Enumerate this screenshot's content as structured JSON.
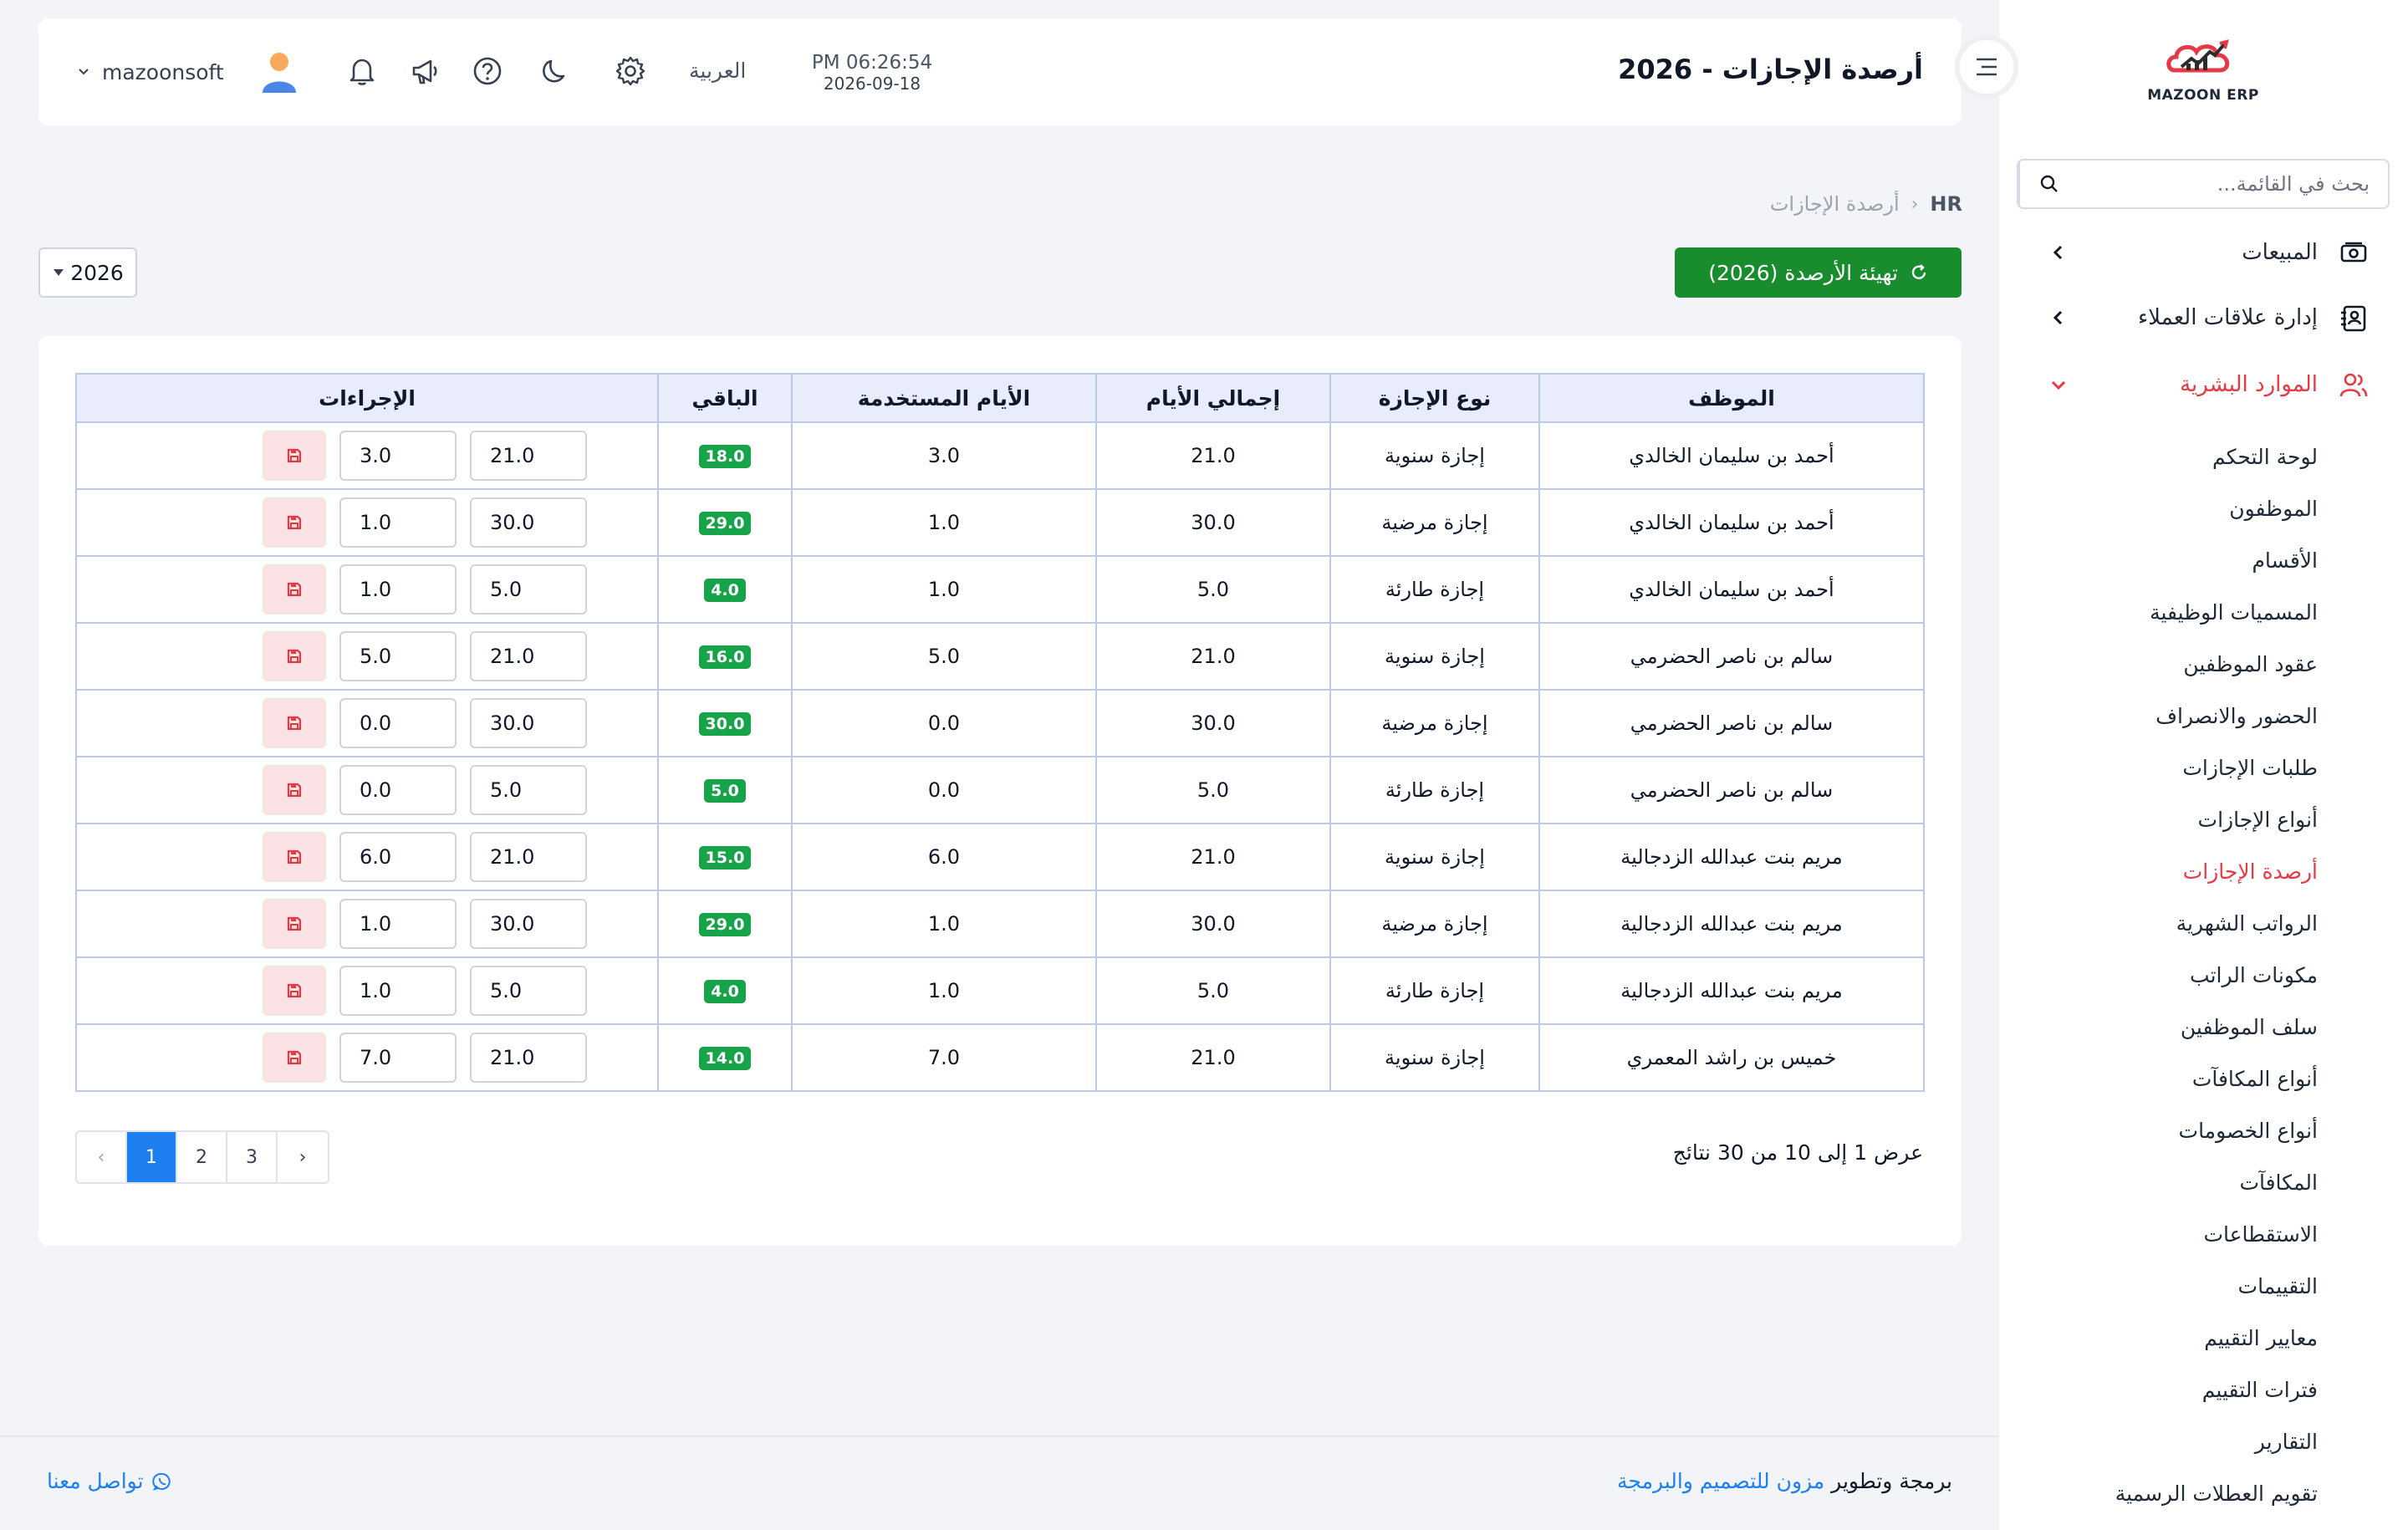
{
  "brand": {
    "logo_text": "MAZOON ERP"
  },
  "sidebar": {
    "search_placeholder": "بحث في القائمة...",
    "groups": [
      {
        "label": "المبيعات",
        "icon": "cash-icon"
      },
      {
        "label": "إدارة علاقات العملاء",
        "icon": "contacts-icon"
      },
      {
        "label": "الموارد البشرية",
        "icon": "users-icon"
      }
    ],
    "hr_items": [
      "لوحة التحكم",
      "الموظفون",
      "الأقسام",
      "المسميات الوظيفية",
      "عقود الموظفين",
      "الحضور والانصراف",
      "طلبات الإجازات",
      "أنواع الإجازات",
      "أرصدة الإجازات",
      "الرواتب الشهرية",
      "مكونات الراتب",
      "سلف الموظفين",
      "أنواع المكافآت",
      "أنواع الخصومات",
      "المكافآت",
      "الاستقطاعات",
      "التقييمات",
      "معايير التقييم",
      "فترات التقييم",
      "التقارير",
      "تقويم العطلات الرسمية"
    ],
    "active_item": "أرصدة الإجازات"
  },
  "header": {
    "title": "أرصدة الإجازات - 2026",
    "time": "PM 06:26:54",
    "date": "2026-09-18",
    "language": "العربية",
    "username": "mazoonsoft"
  },
  "breadcrumb": {
    "home": "HR",
    "separator": "‹",
    "current": "أرصدة الإجازات"
  },
  "controls": {
    "init_button": "تهيئة الأرصدة (2026)",
    "year": "2026"
  },
  "table": {
    "headers": [
      "الموظف",
      "نوع الإجازة",
      "إجمالي الأيام",
      "الأيام المستخدمة",
      "الباقي",
      "الإجراءات"
    ],
    "rows": [
      {
        "employee": "أحمد بن سليمان الخالدي",
        "type": "إجازة سنوية",
        "total": "21.0",
        "used": "3.0",
        "remaining": "18.0"
      },
      {
        "employee": "أحمد بن سليمان الخالدي",
        "type": "إجازة مرضية",
        "total": "30.0",
        "used": "1.0",
        "remaining": "29.0"
      },
      {
        "employee": "أحمد بن سليمان الخالدي",
        "type": "إجازة طارئة",
        "total": "5.0",
        "used": "1.0",
        "remaining": "4.0"
      },
      {
        "employee": "سالم بن ناصر الحضرمي",
        "type": "إجازة سنوية",
        "total": "21.0",
        "used": "5.0",
        "remaining": "16.0"
      },
      {
        "employee": "سالم بن ناصر الحضرمي",
        "type": "إجازة مرضية",
        "total": "30.0",
        "used": "0.0",
        "remaining": "30.0"
      },
      {
        "employee": "سالم بن ناصر الحضرمي",
        "type": "إجازة طارئة",
        "total": "5.0",
        "used": "0.0",
        "remaining": "5.0"
      },
      {
        "employee": "مريم بنت عبدالله الزدجالية",
        "type": "إجازة سنوية",
        "total": "21.0",
        "used": "6.0",
        "remaining": "15.0"
      },
      {
        "employee": "مريم بنت عبدالله الزدجالية",
        "type": "إجازة مرضية",
        "total": "30.0",
        "used": "1.0",
        "remaining": "29.0"
      },
      {
        "employee": "مريم بنت عبدالله الزدجالية",
        "type": "إجازة طارئة",
        "total": "5.0",
        "used": "1.0",
        "remaining": "4.0"
      },
      {
        "employee": "خميس بن راشد المعمري",
        "type": "إجازة سنوية",
        "total": "21.0",
        "used": "7.0",
        "remaining": "14.0"
      }
    ]
  },
  "pagination": {
    "info": "عرض 1 إلى 10 من 30 نتائج",
    "prev": "‹",
    "pages": [
      "1",
      "2",
      "3"
    ],
    "current": "1",
    "next": "›"
  },
  "footer": {
    "credit_prefix": "برمجة وتطوير",
    "credit_link": "مزون للتصميم والبرمجة",
    "contact": "تواصل معنا"
  },
  "colors": {
    "accent_red": "#e53946",
    "primary_green": "#198c2e",
    "link_blue": "#1d7ff0",
    "badge_green": "#16a34a"
  }
}
